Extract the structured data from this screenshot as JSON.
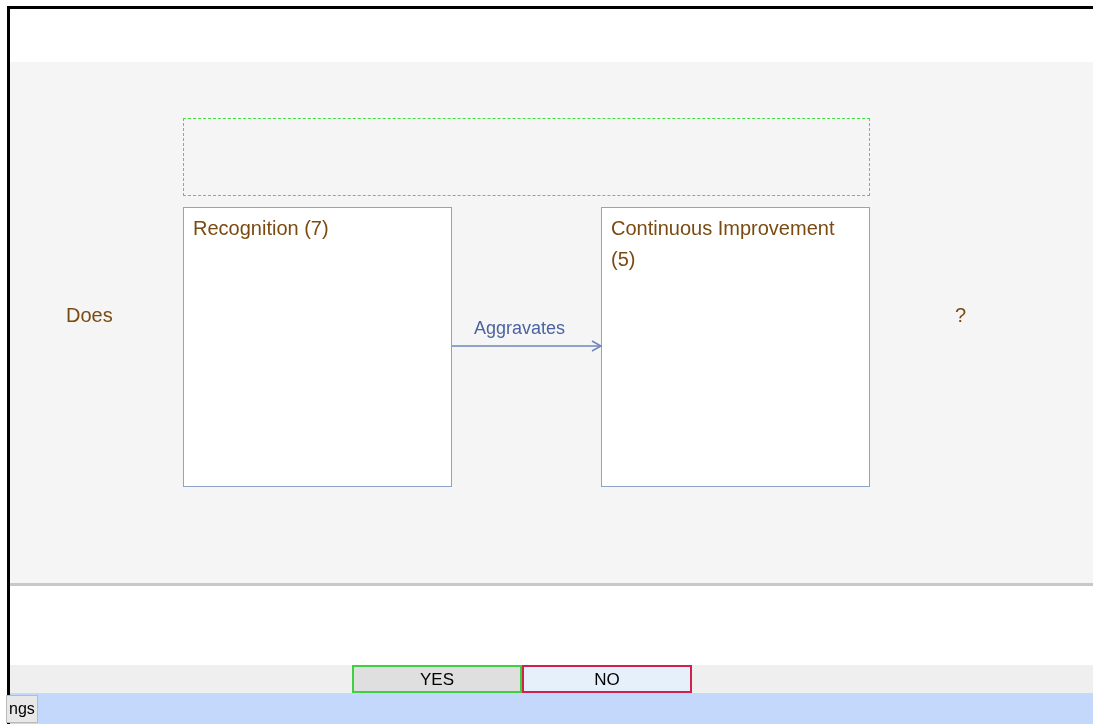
{
  "question": {
    "prefix": "Does",
    "suffix": "?"
  },
  "nodes": [
    {
      "label": "Recognition (7)"
    },
    {
      "label": "Continuous Improvement (5)"
    }
  ],
  "link": {
    "label": "Aggravates"
  },
  "buttons": [
    {
      "label": "YES",
      "kind": "yes"
    },
    {
      "label": "NO",
      "kind": "no"
    }
  ],
  "status_tab": {
    "label": "ngs"
  }
}
